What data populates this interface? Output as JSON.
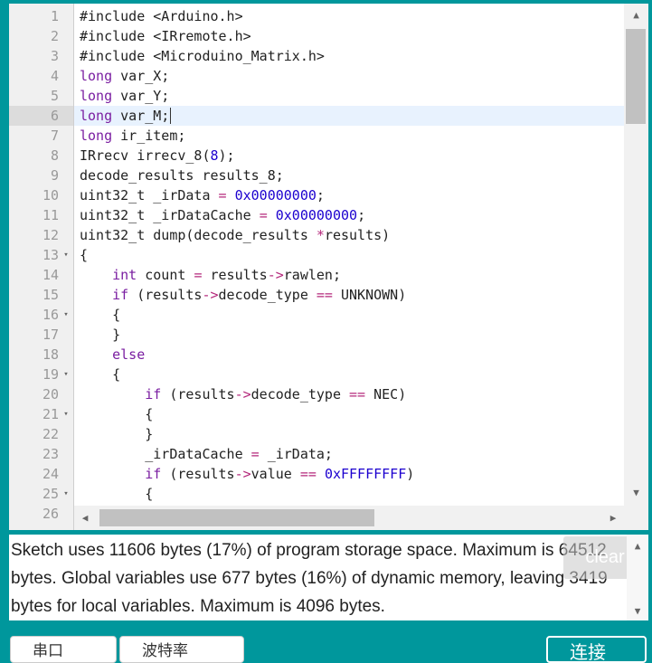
{
  "editor": {
    "active_line": 6,
    "lines": [
      {
        "n": "1",
        "fold": "",
        "html": "#include &lt;Arduino.h&gt;"
      },
      {
        "n": "2",
        "fold": "",
        "html": "#include &lt;IRremote.h&gt;"
      },
      {
        "n": "3",
        "fold": "",
        "html": "#include &lt;Microduino_Matrix.h&gt;"
      },
      {
        "n": "4",
        "fold": "",
        "html": "<span class='t-kw'>long</span> var_X;"
      },
      {
        "n": "5",
        "fold": "",
        "html": "<span class='t-kw'>long</span> var_Y;"
      },
      {
        "n": "6",
        "fold": "",
        "html": "<span class='t-kw'>long</span> var_M;<span class='cursor'></span>"
      },
      {
        "n": "7",
        "fold": "",
        "html": "<span class='t-kw'>long</span> ir_item;"
      },
      {
        "n": "8",
        "fold": "",
        "html": "IRrecv irrecv_8(<span class='t-num'>8</span>);"
      },
      {
        "n": "9",
        "fold": "",
        "html": "decode_results results_8;"
      },
      {
        "n": "10",
        "fold": "",
        "html": "uint32_t _irData <span class='t-op'>=</span> <span class='t-num'>0x00000000</span>;"
      },
      {
        "n": "11",
        "fold": "",
        "html": "uint32_t _irDataCache <span class='t-op'>=</span> <span class='t-num'>0x00000000</span>;"
      },
      {
        "n": "12",
        "fold": "",
        "html": "uint32_t dump(decode_results <span class='t-op'>*</span>results)"
      },
      {
        "n": "13",
        "fold": "▾",
        "html": "{"
      },
      {
        "n": "14",
        "fold": "",
        "html": "    <span class='t-kw'>int</span> count <span class='t-op'>=</span> results<span class='t-op'>-&gt;</span>rawlen;"
      },
      {
        "n": "15",
        "fold": "",
        "html": "    <span class='t-kw'>if</span> (results<span class='t-op'>-&gt;</span>decode_type <span class='t-op'>==</span> UNKNOWN)"
      },
      {
        "n": "16",
        "fold": "▾",
        "html": "    {"
      },
      {
        "n": "17",
        "fold": "",
        "html": "    }"
      },
      {
        "n": "18",
        "fold": "",
        "html": "    <span class='t-kw'>else</span>"
      },
      {
        "n": "19",
        "fold": "▾",
        "html": "    {"
      },
      {
        "n": "20",
        "fold": "",
        "html": "        <span class='t-kw'>if</span> (results<span class='t-op'>-&gt;</span>decode_type <span class='t-op'>==</span> NEC)"
      },
      {
        "n": "21",
        "fold": "▾",
        "html": "        {"
      },
      {
        "n": "22",
        "fold": "",
        "html": "        }"
      },
      {
        "n": "23",
        "fold": "",
        "html": "        _irDataCache <span class='t-op'>=</span> _irData;"
      },
      {
        "n": "24",
        "fold": "",
        "html": "        <span class='t-kw'>if</span> (results<span class='t-op'>-&gt;</span>value <span class='t-op'>==</span> <span class='t-num'>0xFFFFFFFF</span>)"
      },
      {
        "n": "25",
        "fold": "▾",
        "html": "        {"
      },
      {
        "n": "26",
        "fold": "",
        "html": ""
      }
    ]
  },
  "console": {
    "text": "Sketch uses 11606 bytes (17%) of program storage space. Maximum is 64512 bytes. Global variables use 677 bytes (16%) of dynamic memory, leaving 3419 bytes for local variables. Maximum is 4096 bytes.",
    "clear_label": "clear"
  },
  "buttons": {
    "serial_label": "串口",
    "baud_label": "波特率",
    "connect_label": "连接"
  }
}
